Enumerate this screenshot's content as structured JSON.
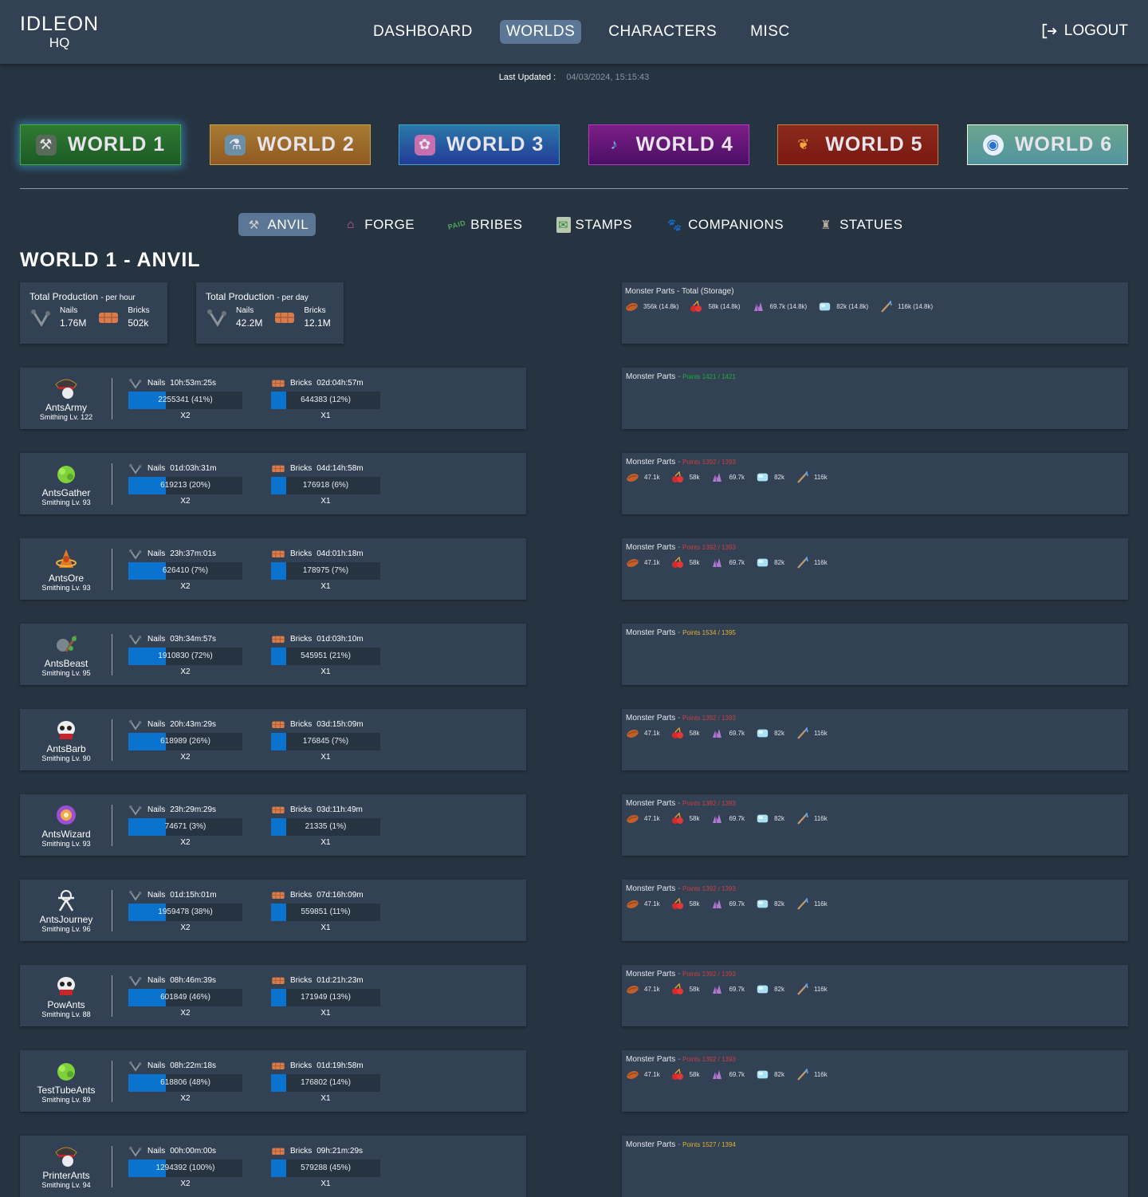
{
  "app": {
    "logo_line1": "IDLEON",
    "logo_line2": "HQ"
  },
  "nav": {
    "items": [
      {
        "label": "DASHBOARD",
        "active": false
      },
      {
        "label": "WORLDS",
        "active": true
      },
      {
        "label": "CHARACTERS",
        "active": false
      },
      {
        "label": "MISC",
        "active": false
      }
    ],
    "logout_label": "LOGOUT",
    "logout_icon": "logout-icon"
  },
  "last_updated": {
    "label": "Last Updated :",
    "value": "04/03/2024, 15:15:43"
  },
  "worlds": [
    {
      "label": "WORLD 1",
      "icon": "world1-anvil-icon",
      "active": true
    },
    {
      "label": "WORLD 2",
      "icon": "world2-icon",
      "active": false
    },
    {
      "label": "WORLD 3",
      "icon": "world3-icon",
      "active": false
    },
    {
      "label": "WORLD 4",
      "icon": "world4-icon",
      "active": false
    },
    {
      "label": "WORLD 5",
      "icon": "world5-icon",
      "active": false
    },
    {
      "label": "WORLD 6",
      "icon": "world6-icon",
      "active": false
    }
  ],
  "subtabs": [
    {
      "label": "ANVIL",
      "icon": "anvil-icon",
      "active": true
    },
    {
      "label": "FORGE",
      "icon": "forge-icon",
      "active": false
    },
    {
      "label": "BRIBES",
      "icon": "bribes-icon",
      "active": false
    },
    {
      "label": "STAMPS",
      "icon": "stamps-icon",
      "active": false
    },
    {
      "label": "COMPANIONS",
      "icon": "companions-icon",
      "active": false
    },
    {
      "label": "STATUES",
      "icon": "statues-icon",
      "active": false
    }
  ],
  "page_title": "WORLD 1 - ANVIL",
  "production": [
    {
      "title": "Total Production",
      "period": "- per hour",
      "nails_label": "Nails",
      "nails": "1.76M",
      "bricks_label": "Bricks",
      "bricks": "502k"
    },
    {
      "title": "Total Production",
      "period": "- per day",
      "nails_label": "Nails",
      "nails": "42.2M",
      "bricks_label": "Bricks",
      "bricks": "12.1M"
    }
  ],
  "monster_total": {
    "title": "Monster Parts - Total (Storage)",
    "parts": [
      {
        "icon": "meat-icon",
        "value": "356k (14.8k)"
      },
      {
        "icon": "cherries-icon",
        "value": "58k (14.8k)"
      },
      {
        "icon": "crystal-icon",
        "value": "69.7k (14.8k)"
      },
      {
        "icon": "ice-cube-icon",
        "value": "82k (14.8k)"
      },
      {
        "icon": "stick-icon",
        "value": "116k (14.8k)"
      }
    ]
  },
  "labels": {
    "monster_parts": "Monster Parts",
    "dash": "-",
    "nails": "Nails",
    "bricks": "Bricks"
  },
  "characters": [
    {
      "name": "AntsArmy",
      "level": "Smithing Lv. 122",
      "avatar": "pirate-hat-avatar",
      "nails_time": "10h:53m:25s",
      "nails_bar": "2255341 (41%)",
      "nails_mult": "X2",
      "bricks_time": "02d:04h:57m",
      "bricks_bar": "644383 (12%)",
      "bricks_mult": "X1",
      "points": "Points 1421 / 1421",
      "points_status": "ok",
      "parts": []
    },
    {
      "name": "AntsGather",
      "level": "Smithing Lv. 93",
      "avatar": "green-blob-avatar",
      "nails_time": "01d:03h:31m",
      "nails_bar": "619213 (20%)",
      "nails_mult": "X2",
      "bricks_time": "04d:14h:58m",
      "bricks_bar": "176918 (6%)",
      "bricks_mult": "X1",
      "points": "Points 1392 / 1393",
      "points_status": "low",
      "parts": [
        "47.1k",
        "58k",
        "69.7k",
        "82k",
        "116k"
      ]
    },
    {
      "name": "AntsOre",
      "level": "Smithing Lv. 93",
      "avatar": "orange-orb-avatar",
      "nails_time": "23h:37m:01s",
      "nails_bar": "626410 (7%)",
      "nails_mult": "X2",
      "bricks_time": "04d:01h:18m",
      "bricks_bar": "178975 (7%)",
      "bricks_mult": "X1",
      "points": "Points 1392 / 1393",
      "points_status": "low",
      "parts": [
        "47.1k",
        "58k",
        "69.7k",
        "82k",
        "116k"
      ]
    },
    {
      "name": "AntsBeast",
      "level": "Smithing Lv. 95",
      "avatar": "beast-avatar",
      "nails_time": "03h:34m:57s",
      "nails_bar": "1910830 (72%)",
      "nails_mult": "X2",
      "bricks_time": "01d:03h:10m",
      "bricks_bar": "545951 (21%)",
      "bricks_mult": "X1",
      "points": "Points 1534 / 1395",
      "points_status": "over",
      "parts": []
    },
    {
      "name": "AntsBarb",
      "level": "Smithing Lv. 90",
      "avatar": "skull-avatar",
      "nails_time": "20h:43m:29s",
      "nails_bar": "618989 (26%)",
      "nails_mult": "X2",
      "bricks_time": "03d:15h:09m",
      "bricks_bar": "176845 (7%)",
      "bricks_mult": "X1",
      "points": "Points 1392 / 1393",
      "points_status": "low",
      "parts": [
        "47.1k",
        "58k",
        "69.7k",
        "82k",
        "116k"
      ]
    },
    {
      "name": "AntsWizard",
      "level": "Smithing Lv. 93",
      "avatar": "wizard-orb-avatar",
      "nails_time": "23h:29m:29s",
      "nails_bar": "74671 (3%)",
      "nails_mult": "X2",
      "bricks_time": "03d:11h:49m",
      "bricks_bar": "21335 (1%)",
      "bricks_mult": "X1",
      "points": "Points 1392 / 1393",
      "points_status": "low",
      "parts": [
        "47.1k",
        "58k",
        "69.7k",
        "82k",
        "116k"
      ]
    },
    {
      "name": "AntsJourney",
      "level": "Smithing Lv. 96",
      "avatar": "journey-avatar",
      "nails_time": "01d:15h:01m",
      "nails_bar": "1959478 (38%)",
      "nails_mult": "X2",
      "bricks_time": "07d:16h:09m",
      "bricks_bar": "559851 (11%)",
      "bricks_mult": "X1",
      "points": "Points 1392 / 1393",
      "points_status": "low",
      "parts": [
        "47.1k",
        "58k",
        "69.7k",
        "82k",
        "116k"
      ]
    },
    {
      "name": "PowAnts",
      "level": "Smithing Lv. 88",
      "avatar": "skull-avatar",
      "nails_time": "08h:46m:39s",
      "nails_bar": "601849 (46%)",
      "nails_mult": "X2",
      "bricks_time": "01d:21h:23m",
      "bricks_bar": "171949 (13%)",
      "bricks_mult": "X1",
      "points": "Points 1392 / 1393",
      "points_status": "low",
      "parts": [
        "47.1k",
        "58k",
        "69.7k",
        "82k",
        "116k"
      ]
    },
    {
      "name": "TestTubeAnts",
      "level": "Smithing Lv. 89",
      "avatar": "green-blob-avatar",
      "nails_time": "08h:22m:18s",
      "nails_bar": "618806 (48%)",
      "nails_mult": "X2",
      "bricks_time": "01d:19h:58m",
      "bricks_bar": "176802 (14%)",
      "bricks_mult": "X1",
      "points": "Points 1392 / 1393",
      "points_status": "low",
      "parts": [
        "47.1k",
        "58k",
        "69.7k",
        "82k",
        "116k"
      ]
    },
    {
      "name": "PrinterAnts",
      "level": "Smithing Lv. 94",
      "avatar": "pirate-hat-avatar",
      "nails_time": "00h:00m:00s",
      "nails_bar": "1294392 (100%)",
      "nails_mult": "X2",
      "bricks_time": "09h:21m:29s",
      "bricks_bar": "579288 (45%)",
      "bricks_mult": "X1",
      "points": "Points 1527 / 1394",
      "points_status": "over",
      "parts": []
    }
  ],
  "bar_fill": {
    "nails": 0.33,
    "bricks": 0.14
  },
  "colors": {
    "accent": "#5b7795",
    "bar_fill": "#0a73cf",
    "points_ok": "#1fae3a",
    "points_low": "#c94142",
    "points_over": "#e0b23a"
  }
}
